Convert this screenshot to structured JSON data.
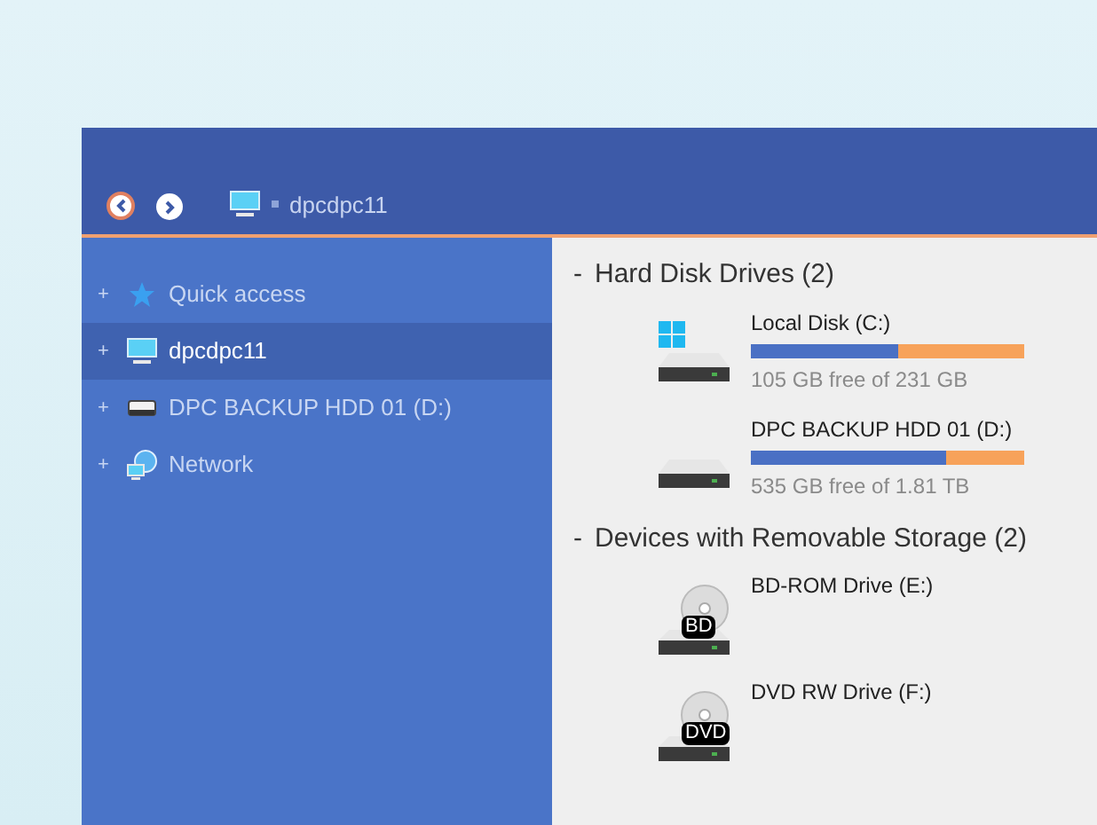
{
  "toolbar": {
    "breadcrumb": "dpcdpc11"
  },
  "sidebar": {
    "items": [
      {
        "expander": "+",
        "label": "Quick access",
        "kind": "star",
        "selected": false
      },
      {
        "expander": "+",
        "label": "dpcdpc11",
        "kind": "computer",
        "selected": true
      },
      {
        "expander": "+",
        "label": "DPC BACKUP HDD 01 (D:)",
        "kind": "drive",
        "selected": false
      },
      {
        "expander": "+",
        "label": "Network",
        "kind": "network",
        "selected": false
      }
    ]
  },
  "groups": [
    {
      "collapser": "-",
      "title": "Hard Disk Drives (2)",
      "drives": [
        {
          "kind": "system",
          "name": "Local Disk (C:)",
          "level": 0.54,
          "free": "105 GB free of 231 GB"
        },
        {
          "kind": "hdd",
          "name": "DPC BACKUP HDD 01 (D:)",
          "level": 0.715,
          "free": "535 GB free of 1.81 TB"
        }
      ]
    },
    {
      "collapser": "-",
      "title": "Devices with Removable Storage (2)",
      "drives": [
        {
          "kind": "optical",
          "name": "BD-ROM Drive (E:)",
          "disc_label": "BD"
        },
        {
          "kind": "optical",
          "name": "DVD RW Drive (F:)",
          "disc_label": "DVD"
        }
      ]
    }
  ]
}
